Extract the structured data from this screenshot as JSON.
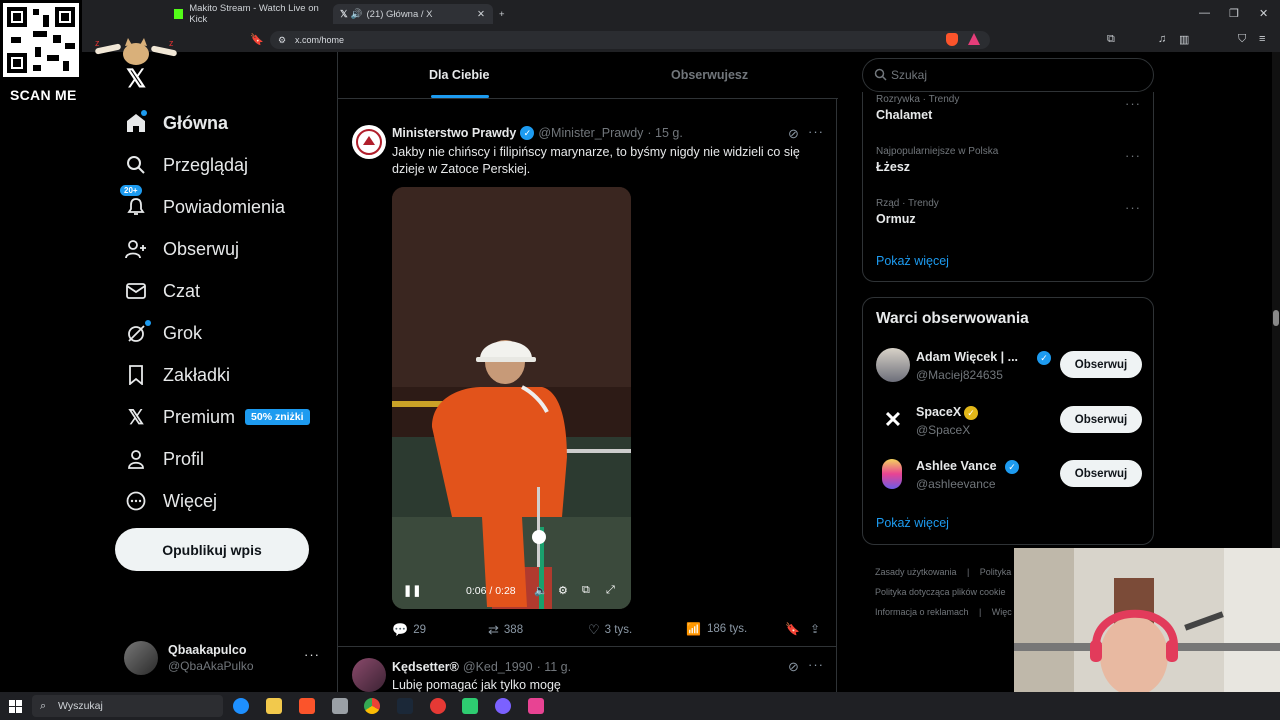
{
  "browser": {
    "tab1_title": "Makito Stream - Watch Live on Kick",
    "tab2_title": "(21) Główna / X",
    "new_tab": "+",
    "url": "x.com/home"
  },
  "overlay": {
    "scan_label": "SCAN ME"
  },
  "sidebar": {
    "logo": "𝕏",
    "items": [
      {
        "label": "Główna",
        "icon": "home-icon"
      },
      {
        "label": "Przeglądaj",
        "icon": "search-icon"
      },
      {
        "label": "Powiadomienia",
        "icon": "bell-icon"
      },
      {
        "label": "Obserwuj",
        "icon": "follow-icon"
      },
      {
        "label": "Czat",
        "icon": "mail-icon"
      },
      {
        "label": "Grok",
        "icon": "grok-icon"
      },
      {
        "label": "Zakładki",
        "icon": "bookmark-icon"
      },
      {
        "label": "Premium",
        "icon": "x-icon"
      },
      {
        "label": "Profil",
        "icon": "user-icon"
      },
      {
        "label": "Więcej",
        "icon": "more-icon"
      }
    ],
    "notifications_badge": "20+",
    "premium_badge": "50% zniżki",
    "post_button": "Opublikuj wpis",
    "user": {
      "name": "Qbaakapulco",
      "handle": "@QbaAkaPulko"
    }
  },
  "main": {
    "tabs": [
      "Dla Ciebie",
      "Obserwujesz"
    ],
    "tweet": {
      "author": "Ministerstwo Prawdy",
      "handle": "@Minister_Prawdy",
      "time": "· 15 g.",
      "text": "Jakby nie  chińscy i filipińscy marynarze, to byśmy nigdy nie widzieli co się dzieje w Zatoce Perskiej.",
      "video_time": "0:06 / 0:28",
      "replies": "29",
      "reposts": "388",
      "likes": "3 tys.",
      "views": "186 tys."
    },
    "next_tweet": {
      "author": "Kędsetter®",
      "handle": "@Ked_1990",
      "time": "· 11 g.",
      "text": "Lubię pomagać jak tylko mogę"
    }
  },
  "right": {
    "search_placeholder": "Szukaj",
    "trends": [
      {
        "meta": "Rozrywka · Trendy",
        "name": "Chalamet"
      },
      {
        "meta": "Najpopularniejsze w Polska",
        "name": "Łżesz"
      },
      {
        "meta": "Rząd · Trendy",
        "name": "Ormuz"
      }
    ],
    "show_more": "Pokaż więcej",
    "who_to_follow_title": "Warci obserwowania",
    "follow": [
      {
        "name": "Adam Więcek | ...",
        "handle": "@Maciej824635",
        "button": "Obserwuj"
      },
      {
        "name": "SpaceX",
        "handle": "@SpaceX",
        "button": "Obserwuj"
      },
      {
        "name": "Ashlee Vance",
        "handle": "@ashleevance",
        "button": "Obserwuj"
      }
    ],
    "footer": [
      "Zasady użytkowania",
      "Polityka",
      "Polityka dotycząca plików cookie",
      "Informacja o reklamach",
      "Więc"
    ]
  },
  "taskbar": {
    "search_label": "Wyszukaj"
  },
  "colors": {
    "accent": "#1d9bf0",
    "bg": "#000000",
    "border": "#2f3336",
    "muted": "#71767b"
  }
}
